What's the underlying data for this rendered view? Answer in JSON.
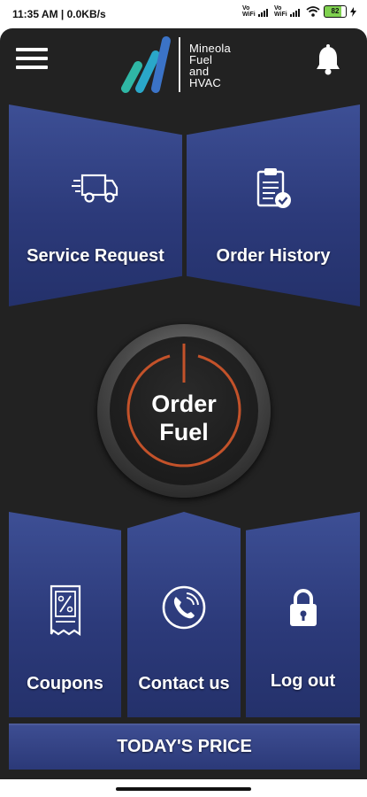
{
  "status_bar": {
    "time": "11:35 AM | 0.0KB/s",
    "vo_wifi_1": "Vo WiFi",
    "vo_wifi_2": "Vo WiFi",
    "battery": "82"
  },
  "header": {
    "logo_text": [
      "Mineola",
      "Fuel",
      "and",
      "HVAC"
    ]
  },
  "tiles": {
    "service_request": "Service Request",
    "order_history": "Order History",
    "order_fuel_line1": "Order",
    "order_fuel_line2": "Fuel",
    "coupons": "Coupons",
    "contact_us": "Contact us",
    "log_out": "Log out",
    "todays_price": "TODAY'S PRICE"
  },
  "colors": {
    "background": "#222222",
    "tile_blue": "#2c3a7a",
    "accent_orange": "#c3522a",
    "logo_teal": "#2fb7a5",
    "logo_blue": "#3b73c7"
  },
  "icons": {
    "menu": "hamburger-menu-icon",
    "notifications": "bell-icon",
    "service": "delivery-truck-icon",
    "history": "clipboard-check-icon",
    "order": "power-icon",
    "coupons": "coupon-icon",
    "contact": "phone-icon",
    "logout": "lock-icon"
  }
}
